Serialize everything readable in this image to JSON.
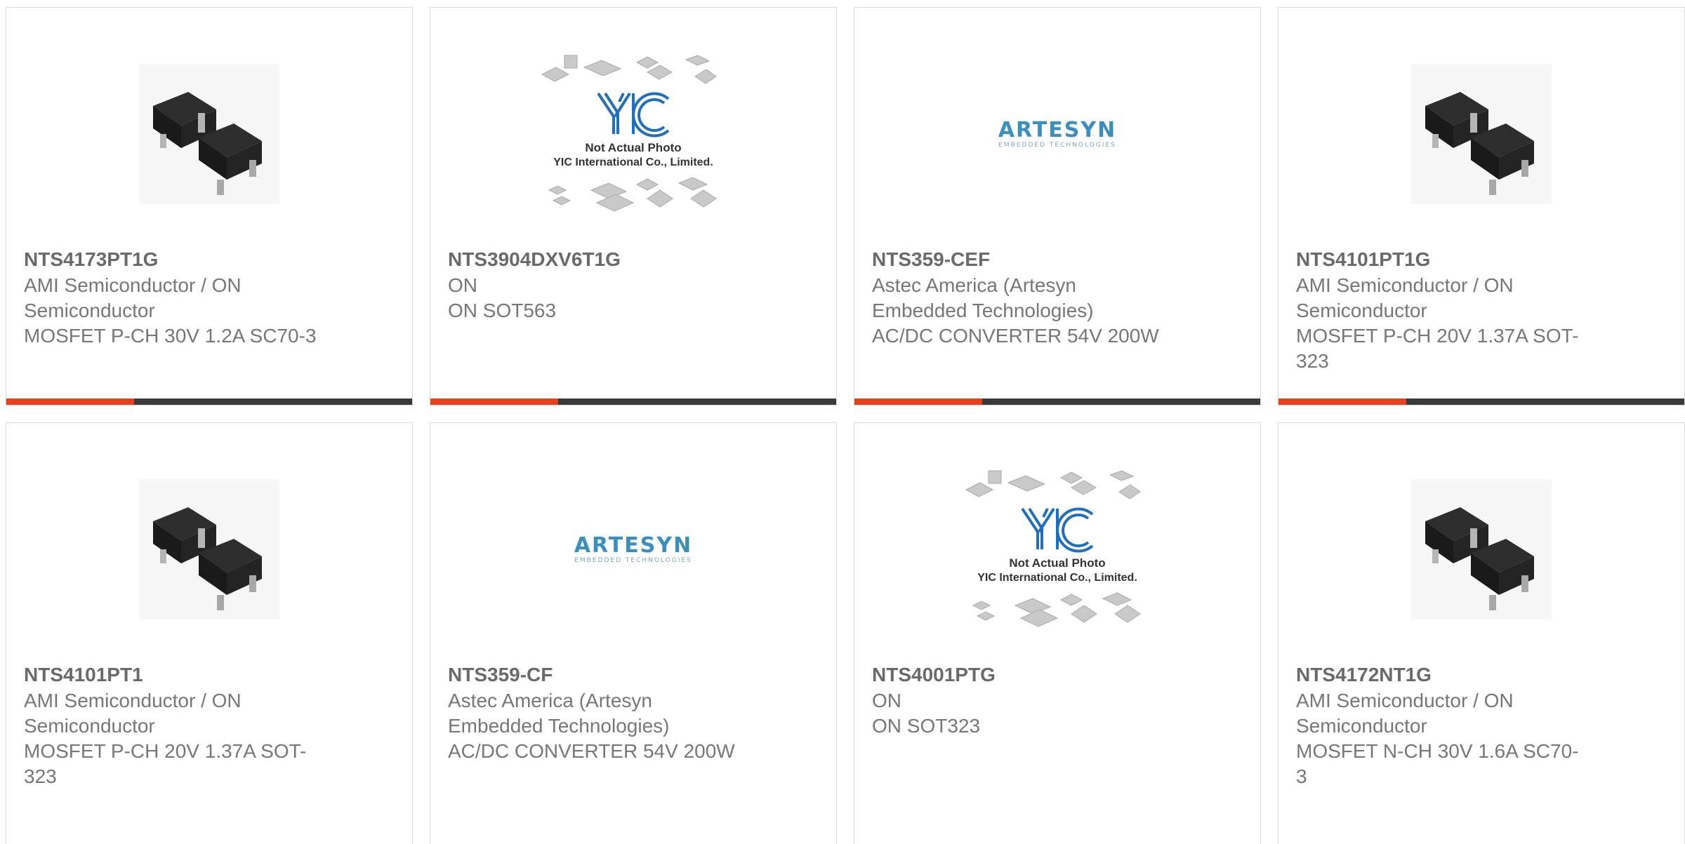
{
  "colors": {
    "accent": "#e8401c",
    "bar": "#3a3a3a",
    "text": "#777777",
    "border": "#dcdcdc"
  },
  "cards": [
    {
      "part": "NTS4173PT1G",
      "manufacturer_line1": "AMI Semiconductor / ON",
      "manufacturer_line2": "Semiconductor",
      "desc_line1": "MOSFET P-CH 30V 1.2A SC70-3",
      "desc_line2": "",
      "image": "sot-package-photo"
    },
    {
      "part": "NTS3904DXV6T1G",
      "manufacturer_line1": "ON",
      "manufacturer_line2": "",
      "desc_line1": "ON SOT563",
      "desc_line2": "",
      "image": "yic-not-actual-photo",
      "img_caption1": "Not Actual Photo",
      "img_caption2": "YIC International Co., Limited.",
      "img_logo": "YIC"
    },
    {
      "part": "NTS359-CEF",
      "manufacturer_line1": "Astec America (Artesyn",
      "manufacturer_line2": "Embedded Technologies)",
      "desc_line1": "AC/DC CONVERTER 54V 200W",
      "desc_line2": "",
      "image": "artesyn-logo",
      "img_logo": "ARTESYN",
      "img_sub": "EMBEDDED TECHNOLOGIES"
    },
    {
      "part": "NTS4101PT1G",
      "manufacturer_line1": "AMI Semiconductor / ON",
      "manufacturer_line2": "Semiconductor",
      "desc_line1": "MOSFET P-CH 20V 1.37A SOT-",
      "desc_line2": "323",
      "image": "sot-package-photo"
    },
    {
      "part": "NTS4101PT1",
      "manufacturer_line1": "AMI Semiconductor / ON",
      "manufacturer_line2": "Semiconductor",
      "desc_line1": "MOSFET P-CH 20V 1.37A SOT-",
      "desc_line2": "323",
      "image": "sot-package-photo"
    },
    {
      "part": "NTS359-CF",
      "manufacturer_line1": "Astec America (Artesyn",
      "manufacturer_line2": "Embedded Technologies)",
      "desc_line1": "AC/DC CONVERTER 54V 200W",
      "desc_line2": "",
      "image": "artesyn-logo",
      "img_logo": "ARTESYN",
      "img_sub": "EMBEDDED TECHNOLOGIES"
    },
    {
      "part": "NTS4001PTG",
      "manufacturer_line1": "ON",
      "manufacturer_line2": "",
      "desc_line1": "ON SOT323",
      "desc_line2": "",
      "image": "yic-not-actual-photo",
      "img_caption1": "Not Actual Photo",
      "img_caption2": "YIC International Co., Limited.",
      "img_logo": "YIC"
    },
    {
      "part": "NTS4172NT1G",
      "manufacturer_line1": "AMI Semiconductor / ON",
      "manufacturer_line2": "Semiconductor",
      "desc_line1": "MOSFET N-CH 30V 1.6A SC70-",
      "desc_line2": "3",
      "image": "sot-package-photo"
    }
  ]
}
